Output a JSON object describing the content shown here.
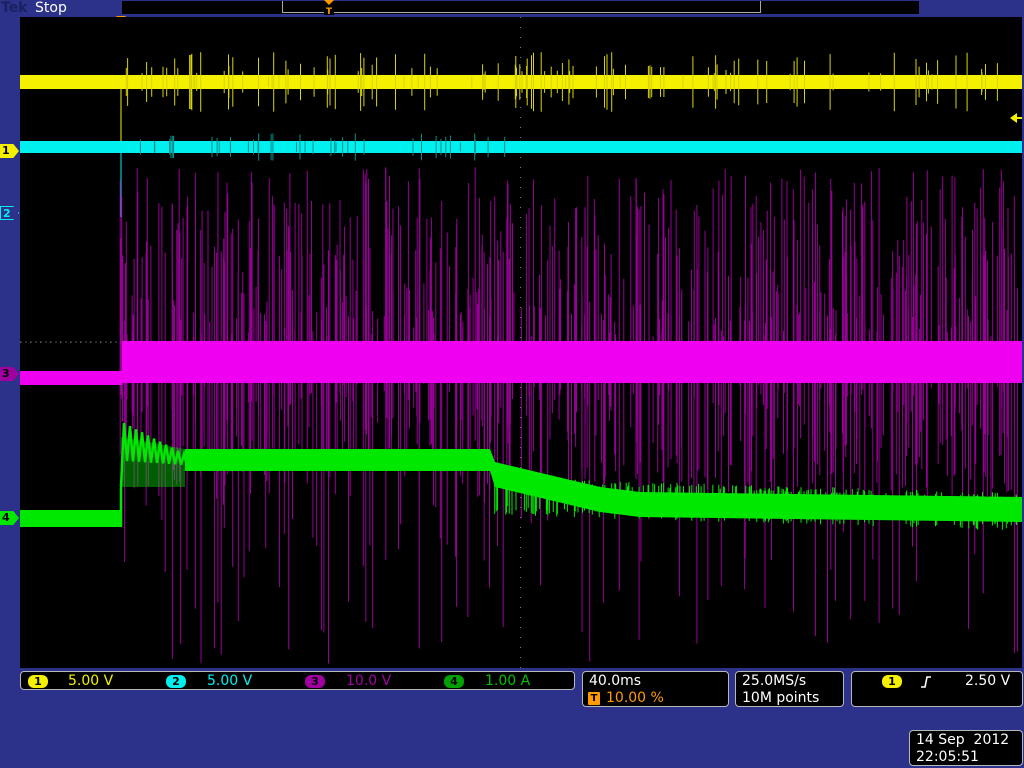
{
  "header": {
    "brand": "Tek",
    "status": "Stop"
  },
  "markers": {
    "trigger_position": "T",
    "channels": [
      "1",
      "2",
      "3",
      "4"
    ]
  },
  "channels": [
    {
      "number": "1",
      "scale": "5.00 V",
      "color": "#f5f000"
    },
    {
      "number": "2",
      "scale": "5.00 V",
      "color": "#00f0f0"
    },
    {
      "number": "3",
      "scale": "10.0 V",
      "color": "#f000f0"
    },
    {
      "number": "4",
      "scale": "1.00 A",
      "color": "#00e800"
    }
  ],
  "timebase": {
    "horizontal_scale": "40.0ms",
    "trigger_icon": "T",
    "trigger_position": "10.00 %"
  },
  "acquisition": {
    "sample_rate": "25.0MS/s",
    "record_length": "10M points"
  },
  "trigger": {
    "source": "1",
    "slope_icon": "rising-edge-icon",
    "level": "2.50 V"
  },
  "datetime": {
    "date": "14 Sep  2012",
    "time": "22:05:51"
  },
  "colors": {
    "screen": "#000000",
    "frame": "#2c318a",
    "grid": "#7a7a7a",
    "orange": "#ff9a00"
  }
}
